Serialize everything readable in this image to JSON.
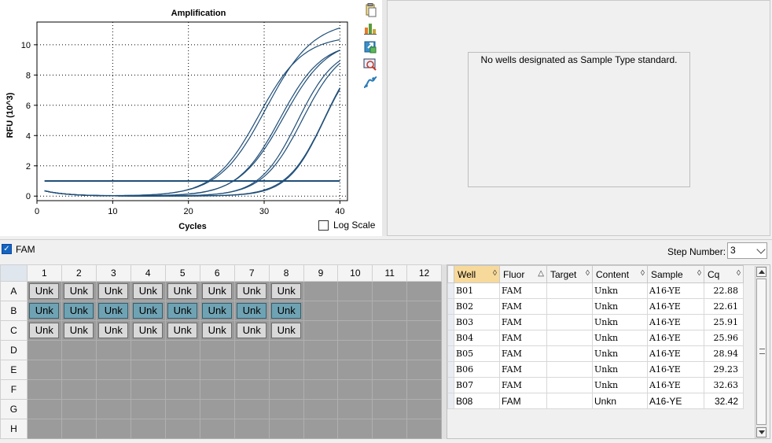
{
  "chart_data": {
    "type": "line",
    "title": "Amplification",
    "xlabel": "Cycles",
    "ylabel": "RFU (10^3)",
    "xlim": [
      0,
      41
    ],
    "ylim": [
      -0.3,
      11.5
    ],
    "xticks": [
      0,
      10,
      20,
      30,
      40
    ],
    "yticks": [
      0,
      2,
      4,
      6,
      8,
      10
    ],
    "grid": true,
    "threshold": 1.0,
    "curve_color": "#1f4e79",
    "series": [
      {
        "label": "B01",
        "cq": 22.88,
        "plateau": 11.6,
        "k": 0.32
      },
      {
        "label": "B02",
        "cq": 22.61,
        "plateau": 10.6,
        "k": 0.34
      },
      {
        "label": "B03",
        "cq": 25.91,
        "plateau": 10.2,
        "k": 0.36
      },
      {
        "label": "B04",
        "cq": 25.96,
        "plateau": 10.4,
        "k": 0.34
      },
      {
        "label": "B05",
        "cq": 28.94,
        "plateau": 9.9,
        "k": 0.4
      },
      {
        "label": "B06",
        "cq": 29.23,
        "plateau": 10.1,
        "k": 0.38
      },
      {
        "label": "B07",
        "cq": 32.63,
        "plateau": 9.9,
        "k": 0.42
      },
      {
        "label": "B08",
        "cq": 32.42,
        "plateau": 10.4,
        "k": 0.4
      }
    ]
  },
  "chart_panel": {
    "log_scale_label": "Log Scale",
    "log_scale_checked": false,
    "toolbar_icons": [
      "copy-icon",
      "chart-bar-icon",
      "export-icon",
      "zoom-icon",
      "curve-icon"
    ]
  },
  "standard_curve": {
    "message": "No wells designated as Sample Type standard."
  },
  "fluor_bar": {
    "fluor_label": "FAM",
    "fluor_checked": true,
    "step_label": "Step Number:",
    "step_value": "3"
  },
  "plate": {
    "columns": [
      "1",
      "2",
      "3",
      "4",
      "5",
      "6",
      "7",
      "8",
      "9",
      "10",
      "11",
      "12"
    ],
    "rows": [
      "A",
      "B",
      "C",
      "D",
      "E",
      "F",
      "G",
      "H"
    ],
    "well_label": "Unk",
    "filled_rows": [
      "A",
      "B",
      "C"
    ],
    "filled_cols": 8,
    "selected_row": "B"
  },
  "results": {
    "headers": [
      "Well",
      "Fluor",
      "Target",
      "Content",
      "Sample",
      "Cq"
    ],
    "sorted_column": "Well",
    "rows": [
      {
        "well": "B01",
        "fluor": "FAM",
        "target": "",
        "content": "Unkn",
        "sample": "A16-YE",
        "cq": "22.88"
      },
      {
        "well": "B02",
        "fluor": "FAM",
        "target": "",
        "content": "Unkn",
        "sample": "A16-YE",
        "cq": "22.61"
      },
      {
        "well": "B03",
        "fluor": "FAM",
        "target": "",
        "content": "Unkn",
        "sample": "A16-YE",
        "cq": "25.91"
      },
      {
        "well": "B04",
        "fluor": "FAM",
        "target": "",
        "content": "Unkn",
        "sample": "A16-YE",
        "cq": "25.96"
      },
      {
        "well": "B05",
        "fluor": "FAM",
        "target": "",
        "content": "Unkn",
        "sample": "A16-YE",
        "cq": "28.94"
      },
      {
        "well": "B06",
        "fluor": "FAM",
        "target": "",
        "content": "Unkn",
        "sample": "A16-YE",
        "cq": "29.23"
      },
      {
        "well": "B07",
        "fluor": "FAM",
        "target": "",
        "content": "Unkn",
        "sample": "A16-YE",
        "cq": "32.63"
      },
      {
        "well": "B08",
        "fluor": "FAM",
        "target": "",
        "content": "Unkn",
        "sample": "A16-YE",
        "cq": "32.42"
      }
    ]
  }
}
